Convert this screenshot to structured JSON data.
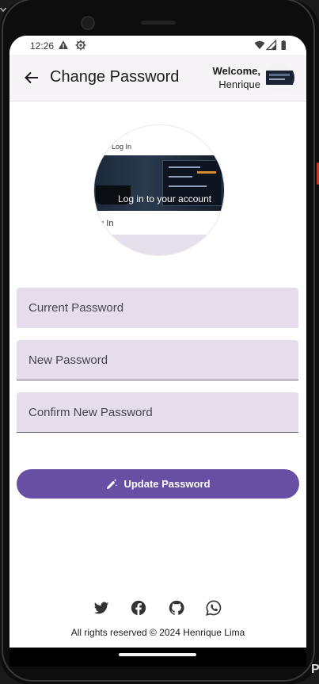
{
  "status_bar": {
    "time": "12:26"
  },
  "app_bar": {
    "title": "Change Password",
    "welcome_line1": "Welcome,",
    "welcome_line2": "Henrique"
  },
  "profile_image": {
    "top_text": "Log In",
    "overlay_text": "Log in to your account",
    "bottom_text": "og In"
  },
  "form": {
    "current_password_label": "Current Password",
    "new_password_label": "New Password",
    "confirm_password_label": "Confirm New Password",
    "submit_label": "Update Password"
  },
  "social_icons": [
    "twitter-icon",
    "facebook-icon",
    "github-icon",
    "whatsapp-icon"
  ],
  "footer": {
    "copyright": "All rights reserved © 2024 Henrique Lima"
  },
  "colors": {
    "primary": "#6750a4",
    "field_fill": "#e5dcec",
    "app_bar_bg": "#f6f4f6",
    "icon_color": "#333333"
  },
  "corner_label": "P"
}
